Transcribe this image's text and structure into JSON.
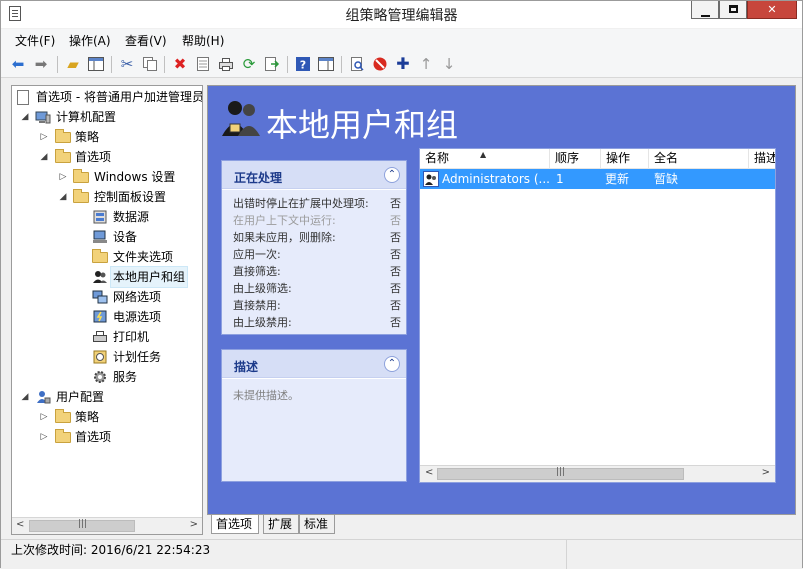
{
  "window": {
    "title": "组策略管理编辑器"
  },
  "menu": [
    {
      "label": "文件(F)"
    },
    {
      "label": "操作(A)"
    },
    {
      "label": "查看(V)"
    },
    {
      "label": "帮助(H)"
    }
  ],
  "toolbar": [
    {
      "icon": "back-arrow-icon"
    },
    {
      "icon": "forward-arrow-icon"
    },
    {
      "icon": "up-folder-icon"
    },
    {
      "icon": "show-tree-icon"
    },
    {
      "icon": "cut-icon"
    },
    {
      "icon": "copy-icon"
    },
    {
      "icon": "delete-icon"
    },
    {
      "icon": "properties-icon"
    },
    {
      "icon": "print-icon"
    },
    {
      "icon": "refresh-icon"
    },
    {
      "icon": "export-list-icon"
    },
    {
      "icon": "help-icon"
    },
    {
      "icon": "action-pane-icon"
    },
    {
      "icon": "preview-icon"
    },
    {
      "icon": "disable-icon"
    },
    {
      "icon": "add-icon"
    },
    {
      "icon": "move-up-icon"
    },
    {
      "icon": "move-down-icon"
    }
  ],
  "tree": {
    "items": [
      {
        "label": "首选项 - 将普通用户加进管理员组"
      },
      {
        "label": "计算机配置"
      },
      {
        "label": "策略"
      },
      {
        "label": "首选项"
      },
      {
        "label": "Windows 设置"
      },
      {
        "label": "控制面板设置"
      },
      {
        "label": "数据源"
      },
      {
        "label": "设备"
      },
      {
        "label": "文件夹选项"
      },
      {
        "label": "本地用户和组"
      },
      {
        "label": "网络选项"
      },
      {
        "label": "电源选项"
      },
      {
        "label": "打印机"
      },
      {
        "label": "计划任务"
      },
      {
        "label": "服务"
      },
      {
        "label": "用户配置"
      },
      {
        "label": "策略"
      },
      {
        "label": "首选项"
      }
    ]
  },
  "main": {
    "title": "本地用户和组",
    "processing_panel": {
      "title": "正在处理",
      "rows": [
        {
          "key": "出错时停止在扩展中处理项:",
          "value": "否"
        },
        {
          "key": "在用户上下文中运行:",
          "value": "否"
        },
        {
          "key": "如果未应用，则删除:",
          "value": "否"
        },
        {
          "key": "应用一次:",
          "value": "否"
        },
        {
          "key": "直接筛选:",
          "value": "否"
        },
        {
          "key": "由上级筛选:",
          "value": "否"
        },
        {
          "key": "直接禁用:",
          "value": "否"
        },
        {
          "key": "由上级禁用:",
          "value": "否"
        }
      ]
    },
    "description_panel": {
      "title": "描述",
      "text": "未提供描述。"
    },
    "list": {
      "columns": [
        "名称",
        "顺序",
        "操作",
        "全名",
        "描述"
      ],
      "rows": [
        {
          "name": "Administrators (...",
          "order": "1",
          "action": "更新",
          "fullname": "暂缺"
        }
      ]
    }
  },
  "tabs": [
    {
      "label": "首选项"
    },
    {
      "label": "扩展"
    },
    {
      "label": "标准"
    }
  ],
  "status": {
    "last_modified": "上次修改时间: 2016/6/21 22:54:23"
  },
  "colors": {
    "main_background": "#5b73d4",
    "panel_header": "#d6def6",
    "selection": "#3399ff"
  }
}
